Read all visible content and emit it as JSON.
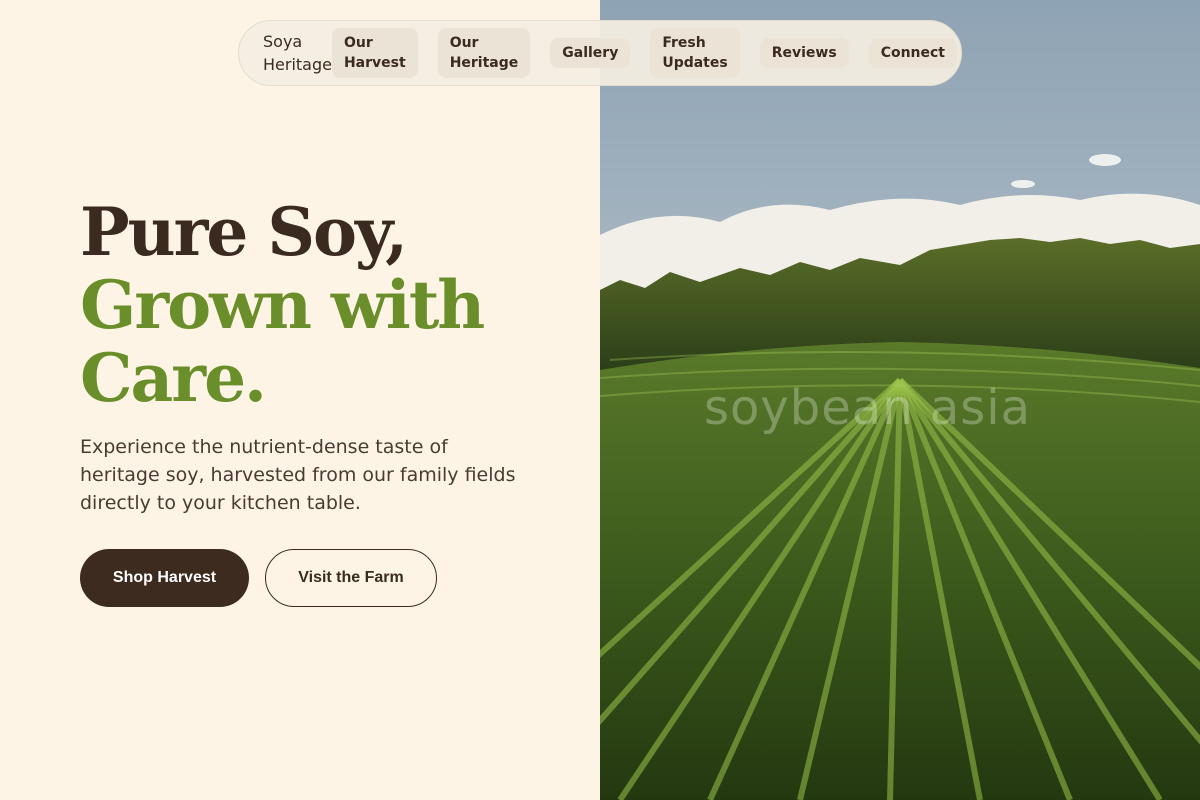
{
  "brand": {
    "name": "Soya Heritage"
  },
  "nav": {
    "items": [
      {
        "label": "Our\nHarvest"
      },
      {
        "label": "Our\nHeritage"
      },
      {
        "label": "Gallery"
      },
      {
        "label": "Fresh\nUpdates"
      },
      {
        "label": "Reviews"
      },
      {
        "label": "Connect"
      }
    ]
  },
  "hero": {
    "headline_line1": "Pure Soy,",
    "headline_line2": "Grown with",
    "headline_line3": "Care.",
    "subtitle": "Experience the nutrient-dense taste of heritage soy, harvested from our family fields directly to your kitchen table.",
    "primary_button": "Shop Harvest",
    "secondary_button": "Visit the Farm",
    "image_watermark": "soybean asia"
  },
  "colors": {
    "background": "#fdf4e6",
    "text_dark": "#3a2a20",
    "accent_green": "#6a8f2a",
    "button_dark": "#3d2b1f"
  }
}
